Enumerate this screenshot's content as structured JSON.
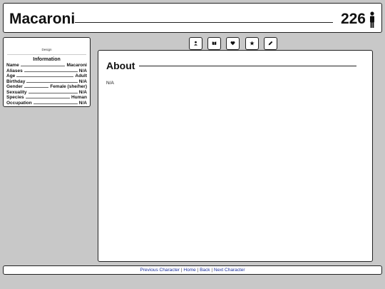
{
  "header": {
    "name": "Macaroni",
    "number": "226",
    "icon": "person-icon"
  },
  "sidebar": {
    "design_label": "Design",
    "info_heading": "Information",
    "info": [
      {
        "label": "Name",
        "value": "Macaroni"
      },
      {
        "label": "Aliases",
        "value": "N/A"
      },
      {
        "label": "Age",
        "value": "Adult"
      },
      {
        "label": "Birthday",
        "value": "N/A"
      },
      {
        "label": "Gender",
        "value": "Female (she/her)"
      },
      {
        "label": "Sexuality",
        "value": "N/A"
      },
      {
        "label": "Species",
        "value": "Human"
      },
      {
        "label": "Occupation",
        "value": "N/A"
      }
    ]
  },
  "tabs": [
    {
      "icon": "user-icon"
    },
    {
      "icon": "book-icon"
    },
    {
      "icon": "heart-icon"
    },
    {
      "icon": "star-icon"
    },
    {
      "icon": "pencil-icon"
    }
  ],
  "main": {
    "title": "About",
    "body": "N/A"
  },
  "footer": {
    "links": [
      "Previous Character",
      "Home",
      "Back",
      "Next Character"
    ],
    "separator": "|"
  }
}
